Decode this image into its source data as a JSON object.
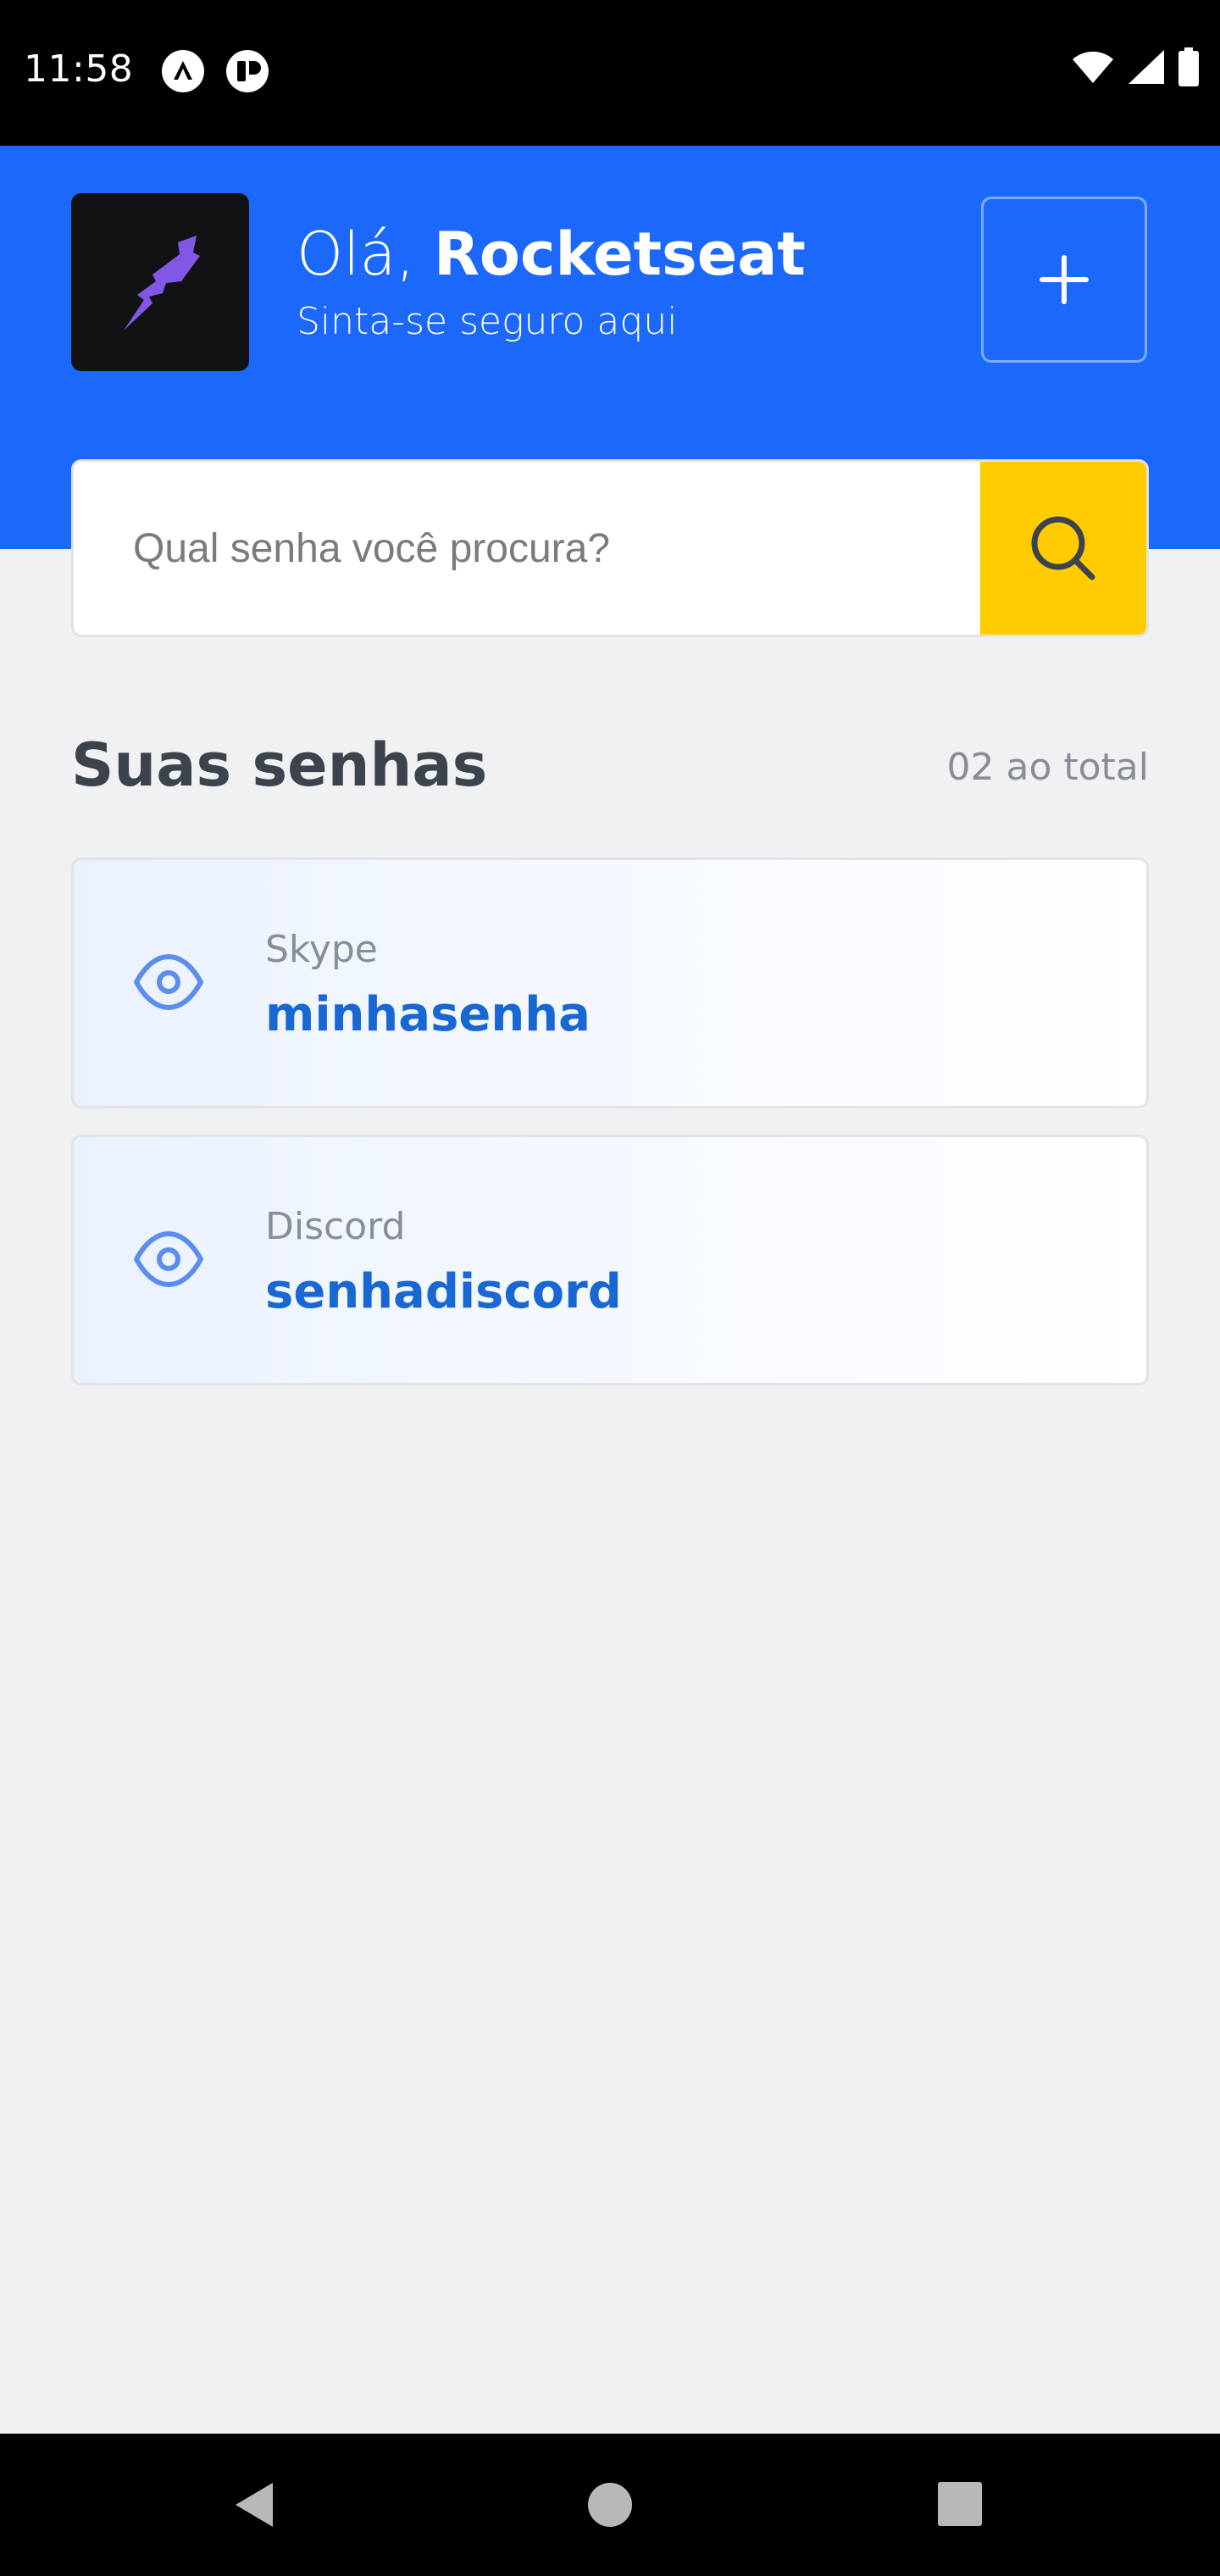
{
  "status_bar": {
    "time": "11:58",
    "icons": [
      "expo-icon",
      "react-icon",
      "wifi-icon",
      "signal-icon",
      "battery-icon"
    ]
  },
  "header": {
    "greeting_prefix": "Olá, ",
    "user_name": "Rocketseat",
    "subtitle": "Sinta-se seguro aqui",
    "add_icon": "plus-icon"
  },
  "search": {
    "placeholder": "Qual senha você procura?",
    "value": "",
    "icon": "search-icon"
  },
  "section": {
    "title": "Suas senhas",
    "count_label": "02 ao total"
  },
  "passwords": [
    {
      "service": "Skype",
      "password": "minhasenha",
      "icon": "eye-icon"
    },
    {
      "service": "Discord",
      "password": "senhadiscord",
      "icon": "eye-icon"
    }
  ],
  "nav": {
    "back": "back-icon",
    "home": "home-icon",
    "recents": "recents-icon"
  },
  "colors": {
    "primary": "#1B68FB",
    "accent": "#FFCC00",
    "background": "#F0F1F3",
    "password_text": "#1967D2",
    "avatar_bg": "#121214",
    "logo": "#8257E5"
  }
}
